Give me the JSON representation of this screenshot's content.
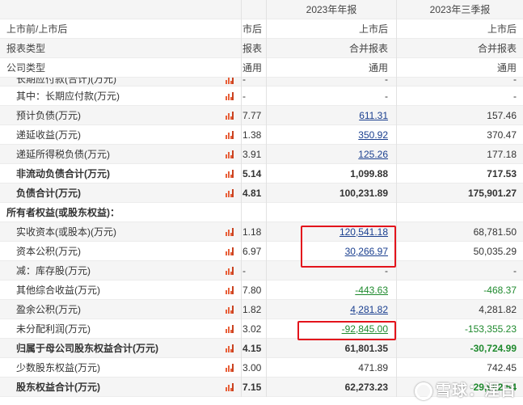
{
  "header": {
    "col0": "",
    "col1": "2023年年报",
    "col2": "2023年三季报"
  },
  "meta_rows": [
    {
      "label": "上市前/上市后",
      "col0": "市后",
      "col1": "上市后",
      "col2": "上市后"
    },
    {
      "label": "报表类型",
      "col0": "报表",
      "col1": "合并报表",
      "col2": "合并报表"
    },
    {
      "label": "公司类型",
      "col0": "通用",
      "col1": "通用",
      "col2": "通用"
    }
  ],
  "cut_row": {
    "label": "长期应付款(合计)(万元)",
    "col0": "-",
    "col1": "-",
    "col2": "-"
  },
  "rows": [
    {
      "label": "其中：长期应付款(万元)",
      "col0": "-",
      "col1": "-",
      "col2": "-"
    },
    {
      "label": "预计负债(万元)",
      "col0": "7.77",
      "col1": "611.31",
      "col2": "157.46"
    },
    {
      "label": "递延收益(万元)",
      "col0": "1.38",
      "col1": "350.92",
      "col2": "370.47"
    },
    {
      "label": "递延所得税负债(万元)",
      "col0": "3.91",
      "col1": "125.26",
      "col2": "177.18"
    },
    {
      "label": "非流动负债合计(万元)",
      "col0": "5.14",
      "col1": "1,099.88",
      "col2": "717.53"
    },
    {
      "label": "负债合计(万元)",
      "col0": "4.81",
      "col1": "100,231.89",
      "col2": "175,901.27"
    },
    {
      "label": "所有者权益(或股东权益)：",
      "col0": "",
      "col1": "",
      "col2": ""
    },
    {
      "label": "实收资本(或股本)(万元)",
      "col0": "1.18",
      "col1": "120,541.18",
      "col2": "68,781.50"
    },
    {
      "label": "资本公积(万元)",
      "col0": "6.97",
      "col1": "30,266.97",
      "col2": "50,035.29"
    },
    {
      "label": "减：库存股(万元)",
      "col0": "-",
      "col1": "-",
      "col2": "-"
    },
    {
      "label": "其他综合收益(万元)",
      "col0": "7.80",
      "col1": "-443.63",
      "col2": "-468.37"
    },
    {
      "label": "盈余公积(万元)",
      "col0": "1.82",
      "col1": "4,281.82",
      "col2": "4,281.82"
    },
    {
      "label": "未分配利润(万元)",
      "col0": "3.02",
      "col1": "-92,845.00",
      "col2": "-153,355.23"
    },
    {
      "label": "归属于母公司股东权益合计(万元)",
      "col0": "4.15",
      "col1": "61,801.35",
      "col2": "-30,724.99"
    },
    {
      "label": "少数股东权益(万元)",
      "col0": "3.00",
      "col1": "471.89",
      "col2": "742.45"
    },
    {
      "label": "股东权益合计(万元)",
      "col0": "7.15",
      "col1": "62,273.23",
      "col2": "-29,982.54"
    }
  ],
  "watermark": {
    "text": "雪球：涅日"
  },
  "colors": {
    "highlight_box": "#e3141c",
    "negative": "#1f8a2e",
    "link": "#1a3f8f",
    "chart_icon": "#e8603a"
  },
  "icons": {
    "row_chart": "bar-chart-icon"
  }
}
